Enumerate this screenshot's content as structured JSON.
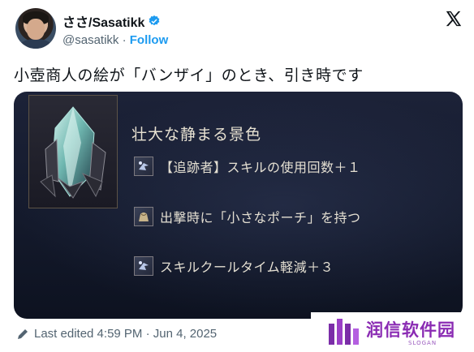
{
  "author": {
    "display_name": "ささ/Sasatikk",
    "handle": "@sasatikk",
    "separator": "·",
    "follow_label": "Follow"
  },
  "tweet": {
    "text": "小壺商人の絵が「バンザイ」のとき、引き時です"
  },
  "media": {
    "skill_title": "壮大な静まる景色",
    "effects": [
      {
        "icon": "skill-icon",
        "text": "【追跡者】スキルの使用回数＋１"
      },
      {
        "icon": "pouch-icon",
        "text": "出撃時に「小さなポーチ」を持つ"
      },
      {
        "icon": "skill-icon",
        "text": "スキルクールタイム軽減＋３"
      }
    ]
  },
  "footer": {
    "edited_label": "Last edited 4:59 PM · Jun 4, 2025"
  },
  "watermark": {
    "text": "润信软件园",
    "slogan": "SLOGAN"
  },
  "colors": {
    "accent": "#1d9bf0",
    "text": "#0f1419",
    "muted": "#536471",
    "watermark": "#8a2bb3"
  }
}
